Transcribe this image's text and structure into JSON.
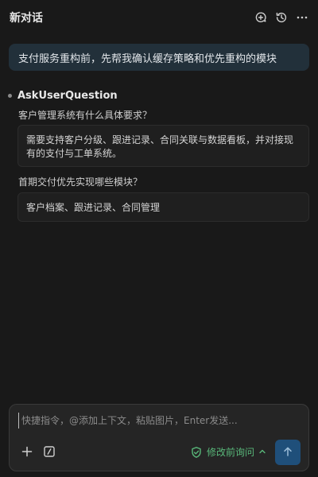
{
  "header": {
    "title": "新对话",
    "icons": [
      "new-chat-icon",
      "history-icon",
      "more-icon"
    ]
  },
  "user_message": {
    "text": "支付服务重构前，先帮我确认缓存策略和优先重构的模块"
  },
  "tool": {
    "name": "AskUserQuestion",
    "questions": [
      {
        "question": "客户管理系统有什么具体要求？",
        "answer": "需要支持客户分级、跟进记录、合同关联与数据看板，并对接现有的支付与工单系统。"
      },
      {
        "question": "首期交付优先实现哪些模块？",
        "answer": "客户档案、跟进记录、合同管理"
      }
    ]
  },
  "composer": {
    "placeholder": "快捷指令，@添加上下文，粘贴图片，Enter发送...",
    "value": "",
    "mode_label": "修改前询问",
    "colors": {
      "mode": "#59b87a",
      "send_bg": "#1f4f7a"
    }
  }
}
